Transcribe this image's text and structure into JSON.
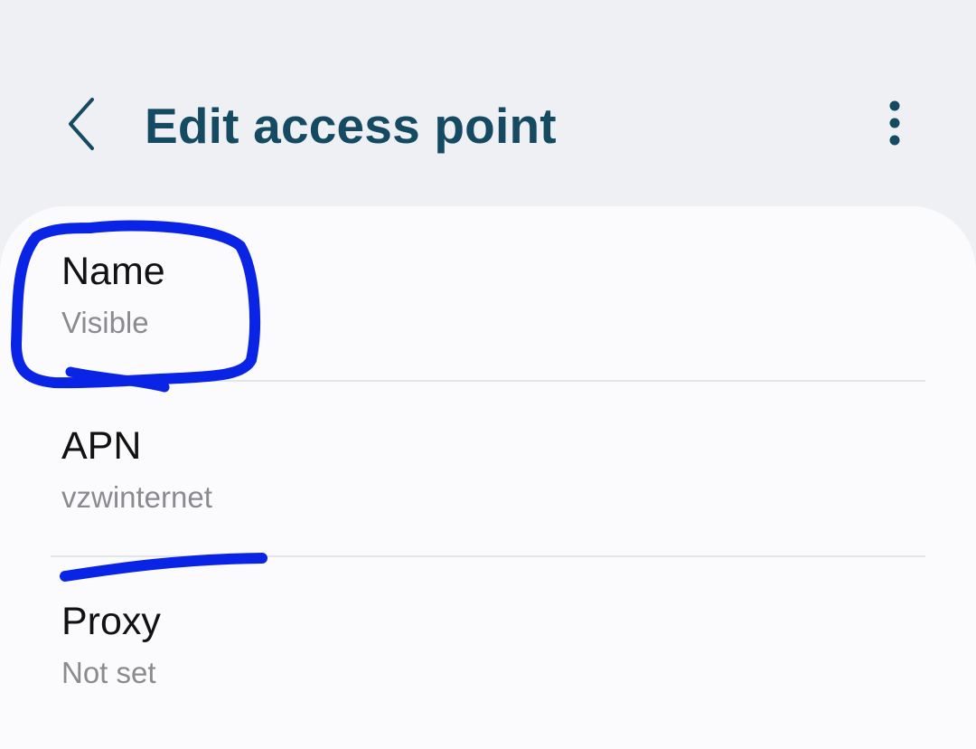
{
  "header": {
    "title": "Edit access point",
    "back_icon": "chevron-left-icon",
    "more_icon": "more-vert-icon"
  },
  "settings": [
    {
      "title": "Name",
      "value": "Visible"
    },
    {
      "title": "APN",
      "value": "vzwinternet"
    },
    {
      "title": "Proxy",
      "value": "Not set"
    }
  ],
  "colors": {
    "title": "#154a63",
    "annotation": "#0a24e6",
    "background": "#eef0f3",
    "card": "#fbfbfd"
  }
}
